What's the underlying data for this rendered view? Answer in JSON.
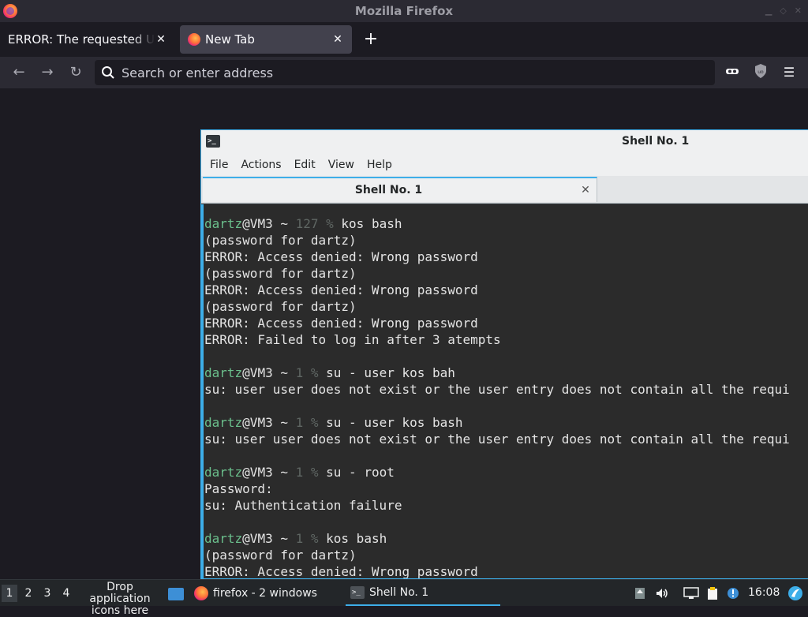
{
  "firefox": {
    "window_title": "Mozilla Firefox",
    "tabs": [
      {
        "title": "ERROR: The requested URL could not be retrieved",
        "active": false
      },
      {
        "title": "New Tab",
        "active": true
      }
    ],
    "new_tab_label": "+",
    "address_placeholder": "Search or enter address"
  },
  "konsole": {
    "window_title": "Shell No. 1",
    "menu": [
      "File",
      "Actions",
      "Edit",
      "View",
      "Help"
    ],
    "tab_label": "Shell No. 1",
    "lines": [
      {
        "user": "dartz",
        "host": "@VM3 ~ ",
        "code": "127 %",
        "cmd": " kos bash"
      },
      {
        "text": "(password for dartz)"
      },
      {
        "text": "ERROR: Access denied: Wrong password"
      },
      {
        "text": "(password for dartz)"
      },
      {
        "text": "ERROR: Access denied: Wrong password"
      },
      {
        "text": "(password for dartz)"
      },
      {
        "text": "ERROR: Access denied: Wrong password"
      },
      {
        "text": "ERROR: Failed to log in after 3 atempts"
      },
      {
        "text": ""
      },
      {
        "user": "dartz",
        "host": "@VM3 ~ ",
        "code": "1 %",
        "cmd": " su - user kos bah"
      },
      {
        "text": "su: user user does not exist or the user entry does not contain all the requi"
      },
      {
        "text": ""
      },
      {
        "user": "dartz",
        "host": "@VM3 ~ ",
        "code": "1 %",
        "cmd": " su - user kos bash"
      },
      {
        "text": "su: user user does not exist or the user entry does not contain all the requi"
      },
      {
        "text": ""
      },
      {
        "user": "dartz",
        "host": "@VM3 ~ ",
        "code": "1 %",
        "cmd": " su - root"
      },
      {
        "text": "Password:"
      },
      {
        "text": "su: Authentication failure"
      },
      {
        "text": ""
      },
      {
        "user": "dartz",
        "host": "@VM3 ~ ",
        "code": "1 %",
        "cmd": " kos bash"
      },
      {
        "text": "(password for dartz)"
      },
      {
        "text": "ERROR: Access denied: Wrong password"
      }
    ]
  },
  "taskbar": {
    "workspaces": [
      "1",
      "2",
      "3",
      "4"
    ],
    "drop_hint": "Drop application icons here",
    "tasks": [
      {
        "label": "firefox - 2 windows",
        "icon": "firefox-icon"
      },
      {
        "label": "Shell No. 1",
        "icon": "terminal-icon"
      }
    ],
    "clock": "16:08"
  },
  "colors": {
    "accent": "#3daee9",
    "prompt_user": "#6bbf8c",
    "prompt_dim": "#5f6663"
  }
}
